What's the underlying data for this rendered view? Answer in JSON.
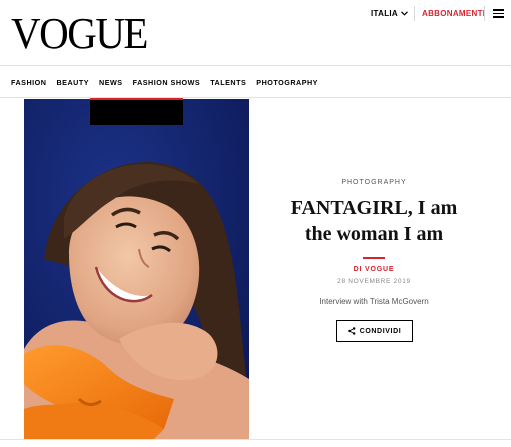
{
  "header": {
    "logo": "VOGUE",
    "country_label": "ITALIA",
    "subscribe_label": "ABBONAMENTI"
  },
  "nav": {
    "items": [
      {
        "label": "FASHION"
      },
      {
        "label": "BEAUTY"
      },
      {
        "label": "NEWS"
      },
      {
        "label": "FASHION SHOWS"
      },
      {
        "label": "TALENTS"
      },
      {
        "label": "PHOTOGRAPHY"
      }
    ]
  },
  "article": {
    "kicker": "PHOTOGRAPHY",
    "title_line1": "FANTAGIRL, I am",
    "title_line2": "the woman I am",
    "byline": "DI VOGUE",
    "date": "28 NOVEMBRE 2019",
    "summary": "Interview with Trista McGovern",
    "share_label": "CONDIVIDI"
  },
  "colors": {
    "accent": "#d6242f",
    "photo_background": "#122266",
    "swimsuit": "#f57a12"
  }
}
